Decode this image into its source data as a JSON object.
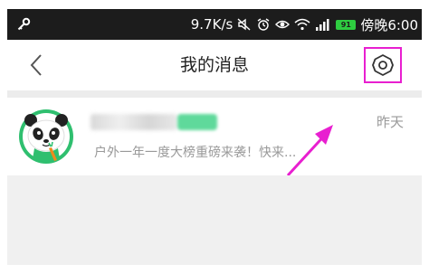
{
  "status_bar": {
    "speed": "9.7K/s",
    "time": "傍晚6:00",
    "battery_level": "91"
  },
  "header": {
    "title": "我的消息"
  },
  "messages": [
    {
      "time": "昨天",
      "preview": "户外一年一度大榜重磅来袭！快来..."
    }
  ],
  "colors": {
    "status_bar": "#1c1c1c",
    "highlight": "#e81fd0",
    "annotation_arrow": "#e81fd0",
    "avatar_ring": "#2fbf6f"
  },
  "icons": {
    "status_left": "key-icon",
    "back": "back-arrow-icon",
    "settings": "gear-icon"
  }
}
